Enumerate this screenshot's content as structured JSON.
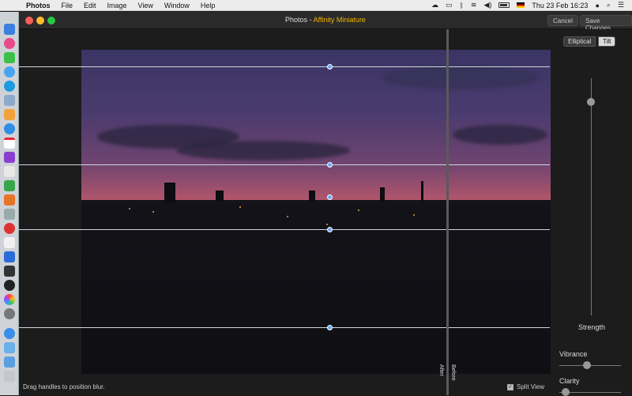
{
  "menubar": {
    "app": "Photos",
    "menus": [
      "File",
      "Edit",
      "Image",
      "View",
      "Window",
      "Help"
    ],
    "clock": "Thu 23 Feb  16:23"
  },
  "window": {
    "title_app": "Photos - ",
    "title_ext": "Affinity Miniature",
    "cancel_label": "Cancel",
    "save_label": "Save Changes"
  },
  "panel": {
    "mode_elliptical": "Elliptical",
    "mode_tilt": "Tilt",
    "selected_mode": "Tilt",
    "strength_label": "Strength",
    "strength_value": 0.9,
    "vibrance_label": "Vibrance",
    "vibrance_value": 0.45,
    "clarity_label": "Clarity",
    "clarity_value": 0.1
  },
  "split": {
    "after_label": "After",
    "before_label": "Before"
  },
  "footer": {
    "hint": "Drag handles to position blur.",
    "split_view_label": "Split View",
    "split_view_checked": true
  },
  "colors": {
    "accent_handle": "#6aa8ff",
    "extension_title": "#f0b400"
  }
}
